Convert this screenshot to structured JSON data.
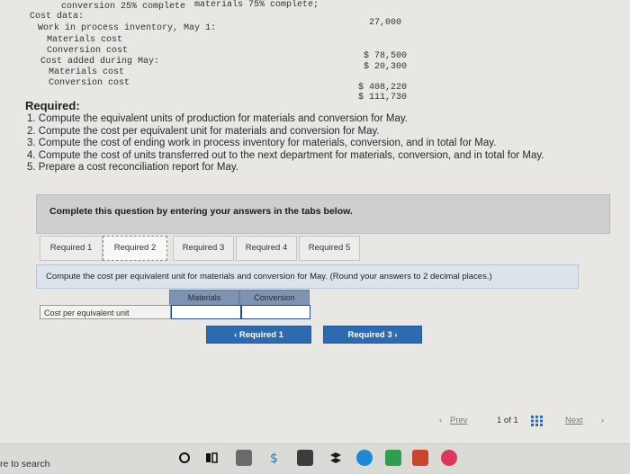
{
  "data_block": {
    "top_line_left": "conversion 25% complete",
    "top_line_right": "materials 75% complete;",
    "cost_data_label": "Cost data:",
    "units_value": "27,000",
    "wip_label": "Work in process inventory, May 1:",
    "materials_cost_label": "Materials cost",
    "conversion_cost_label": "Conversion cost",
    "wip_materials_value": "$ 78,500",
    "wip_conversion_value": "$ 20,300",
    "cost_added_label": "Cost added during May:",
    "added_materials_label": "Materials cost",
    "added_conversion_label": "Conversion cost",
    "added_materials_value": "$ 408,220",
    "added_conversion_value": "$ 111,730"
  },
  "required": {
    "heading": "Required:",
    "items": [
      "1. Compute the equivalent units of production for materials and conversion for May.",
      "2. Compute the cost per equivalent unit for materials and conversion for May.",
      "3. Compute the cost of ending work in process inventory for materials, conversion, and in total for May.",
      "4. Compute the cost of units transferred out to the next department for materials, conversion, and in total for May.",
      "5. Prepare a cost reconciliation report for May."
    ]
  },
  "complete_text": "Complete this question by entering your answers in the tabs below.",
  "tabs": [
    "Required 1",
    "Required 2",
    "Required 3",
    "Required 4",
    "Required 5"
  ],
  "active_tab": "Required 2",
  "instruction": "Compute the cost per equivalent unit for materials and conversion for May. (Round your answers to 2 decimal places.)",
  "table": {
    "columns": [
      "Materials",
      "Conversion"
    ],
    "row_label": "Cost per equivalent unit",
    "materials_value": "",
    "conversion_value": ""
  },
  "nav": {
    "prev_label": "Required 1",
    "next_label": "Required 3"
  },
  "pager": {
    "prev": "Prev",
    "page_text": "1 of 1",
    "next": "Next"
  },
  "taskbar": {
    "search_text": "re to search"
  },
  "colors": {
    "accent_blue": "#2d6ab0",
    "header_blue": "#7e93b0",
    "instruction_bg": "#dde3ea"
  }
}
